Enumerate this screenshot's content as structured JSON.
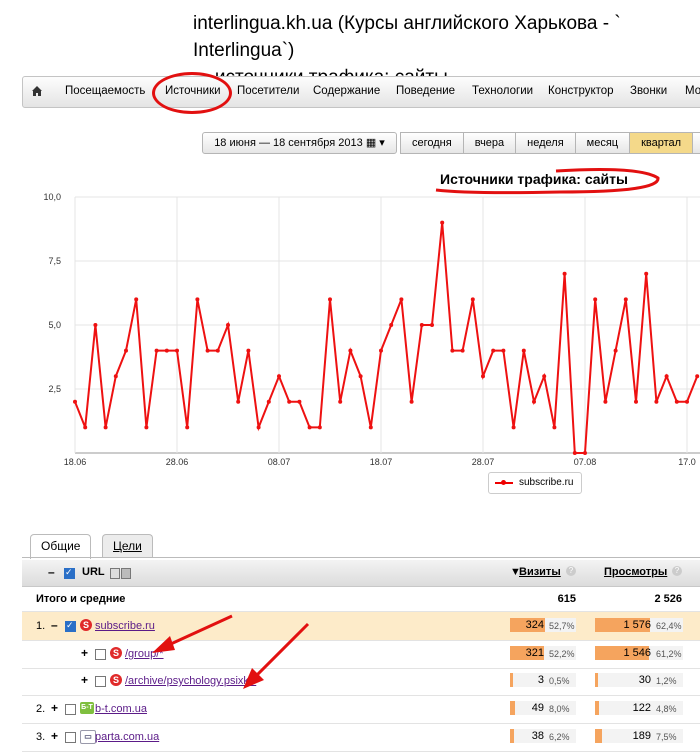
{
  "page_title": {
    "line1": "interlingua.kh.ua (Курсы английского Харькова - ` Interlingua`)",
    "line2": "– источники трафика: сайты"
  },
  "menu": {
    "items": [
      "Посещаемость",
      "Источники",
      "Посетители",
      "Содержание",
      "Поведение",
      "Технологии",
      "Конструктор",
      "Звонки",
      "Мо"
    ]
  },
  "date_range": {
    "label": "18 июня — 18 сентября 2013 ▦ ▾"
  },
  "periods": [
    "сегодня",
    "вчера",
    "неделя",
    "месяц",
    "квартал",
    ""
  ],
  "chart_data": {
    "type": "line",
    "title": "Источники трафика: сайты",
    "x_tick_labels": [
      "18.06",
      "28.06",
      "08.07",
      "18.07",
      "28.07",
      "07.08",
      "17.0"
    ],
    "x_tick_colors": [
      "#333333",
      "#333333",
      "#333333",
      "#333333",
      "#cc0000",
      "#333333",
      "#cc0000"
    ],
    "y_tick_labels": [
      "10,0",
      "7,5",
      "5,0",
      "2,5"
    ],
    "ylim": [
      0,
      10
    ],
    "series": [
      {
        "name": "subscribe.ru",
        "color": "#ee1111",
        "values": [
          2,
          1,
          5,
          1,
          3,
          4,
          6,
          1,
          4,
          4,
          4,
          1,
          6,
          4,
          4,
          5,
          2,
          4,
          1,
          2,
          3,
          2,
          2,
          1,
          1,
          6,
          2,
          4,
          3,
          1,
          4,
          5,
          6,
          2,
          5,
          5,
          9,
          4,
          4,
          6,
          3,
          4,
          4,
          1,
          4,
          2,
          3,
          1,
          7,
          0,
          0,
          6,
          2,
          4,
          6,
          2,
          7,
          2,
          3,
          2,
          2,
          3
        ]
      }
    ],
    "legend": {
      "placement": "bottom-center"
    },
    "grid": true
  },
  "tabs": {
    "general": "Общие",
    "goals": "Цели"
  },
  "table": {
    "header": {
      "url": "URL",
      "visits": "Визиты",
      "views": "Просмотры"
    },
    "totals": {
      "label": "Итого и средние",
      "visits": "615",
      "views": "2 526"
    },
    "rows": [
      {
        "num": "1.",
        "expander": "–",
        "checked": true,
        "icon": "S",
        "name": "subscribe.ru",
        "visits": "324",
        "visits_pct": "52,7%",
        "visits_frac": 0.527,
        "views": "1 576",
        "views_pct": "62,4%",
        "views_frac": 0.624
      },
      {
        "num": "",
        "expander": "+",
        "checked": false,
        "icon": "S",
        "name": "/group/*",
        "visits": "321",
        "visits_pct": "52,2%",
        "visits_frac": 0.522,
        "views": "1 546",
        "views_pct": "61,2%",
        "views_frac": 0.612
      },
      {
        "num": "",
        "expander": "+",
        "checked": false,
        "icon": "S",
        "name": "/archive/psychology.psixk/*",
        "visits": "3",
        "visits_pct": "0,5%",
        "visits_frac": 0.005,
        "views": "30",
        "views_pct": "1,2%",
        "views_frac": 0.012
      },
      {
        "num": "2.",
        "expander": "+",
        "checked": false,
        "icon": "Б-Т",
        "name": "b-t.com.ua",
        "visits": "49",
        "visits_pct": "8,0%",
        "visits_frac": 0.08,
        "views": "122",
        "views_pct": "4,8%",
        "views_frac": 0.048
      },
      {
        "num": "3.",
        "expander": "+",
        "checked": false,
        "icon": "▭",
        "name": "parta.com.ua",
        "visits": "38",
        "visits_pct": "6,2%",
        "visits_frac": 0.062,
        "views": "189",
        "views_pct": "7,5%",
        "views_frac": 0.075
      }
    ]
  },
  "colors": {
    "annotation": "#e21010",
    "bar": "#f5a45e",
    "active_period": "#f4d98a",
    "selected_row": "#fdebc9"
  }
}
